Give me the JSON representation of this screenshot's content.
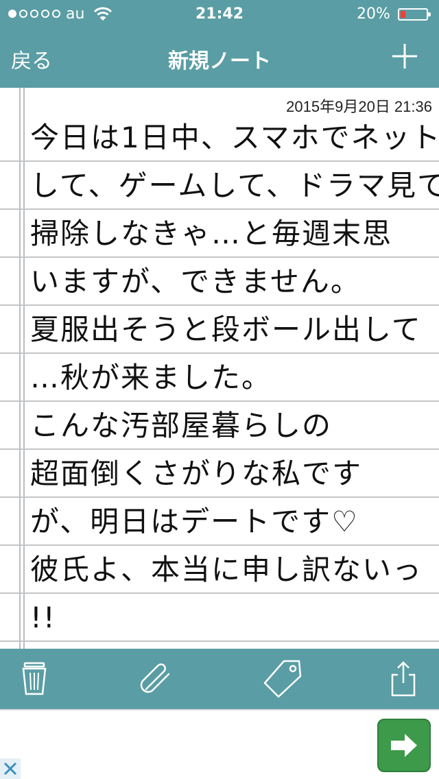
{
  "status_bar": {
    "carrier": "au",
    "time": "21:42",
    "battery_percent": "20%",
    "battery_level": 0.2,
    "signal_strength": 1,
    "signal_max": 5
  },
  "nav": {
    "back_label": "戻る",
    "title": "新規ノート"
  },
  "note": {
    "timestamp": "2015年9月20日 21:36",
    "lines": [
      "今日は1日中、スマホでネット",
      "して、ゲームして、ドラマ見て…。",
      "掃除しなきゃ…と毎週末思",
      "いますが、できません。",
      "夏服出そうと段ボール出して",
      "…秋が来ました。",
      "こんな汚部屋暮らしの",
      "超面倒くさがりな私です",
      "が、明日はデートです♡",
      "彼氏よ、本当に申し訳ないっ",
      "!!"
    ]
  },
  "toolbar": {
    "icons": [
      "trash-icon",
      "paperclip-icon",
      "tag-icon",
      "share-icon"
    ]
  },
  "colors": {
    "accent": "#5a9da4",
    "ad_button": "#3c9a4a",
    "battery_low": "#ff3b30"
  }
}
